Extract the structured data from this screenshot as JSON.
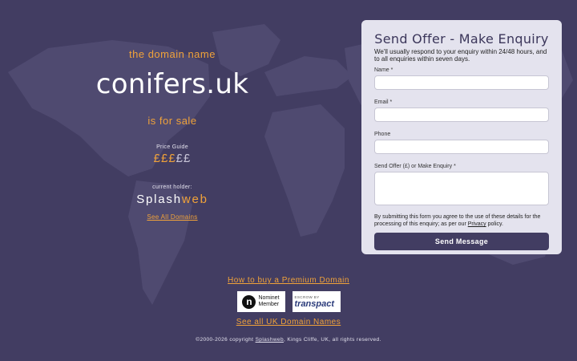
{
  "colors": {
    "background": "#423d62",
    "accent": "#f0a23a",
    "card": "#e4e3ee",
    "button": "#423d62"
  },
  "hero": {
    "lead": "the domain name",
    "domain": "conifers.uk",
    "for_sale": "is for sale",
    "price_guide_label": "Price Guide",
    "price_guide": {
      "on": "£££",
      "off": "££",
      "level": 3,
      "max": 5
    },
    "holder_label": "current holder:",
    "holder_name_a": "Splash",
    "holder_name_b": "web",
    "see_all_domains": "See All Domains"
  },
  "form": {
    "title": "Send Offer - Make Enquiry",
    "subtitle": "We'll usually respond to your enquiry within 24/48 hours, and to all enquiries within seven days.",
    "name_label": "Name *",
    "email_label": "Email *",
    "phone_label": "Phone",
    "offer_label": "Send Offer (£) or Make Enquiry *",
    "terms_before": "By submitting this form you agree to the use of these details for the processing of this enquiry; as per our ",
    "terms_link": "Privacy",
    "terms_after": " policy.",
    "submit_label": "Send Message"
  },
  "footer": {
    "how_to_buy": "How to buy a Premium Domain",
    "nominet_glyph": "n",
    "nominet_text_1": "Nominet",
    "nominet_text_2": "Member",
    "escrow_small": "ESCROW BY",
    "escrow_brand": "transpact",
    "see_all_uk": "See all UK Domain Names",
    "copyright_before": "©2000-2026 copyright ",
    "copyright_link": "Splashweb",
    "copyright_after": ", Kings Cliffe, UK, all rights reserved."
  }
}
